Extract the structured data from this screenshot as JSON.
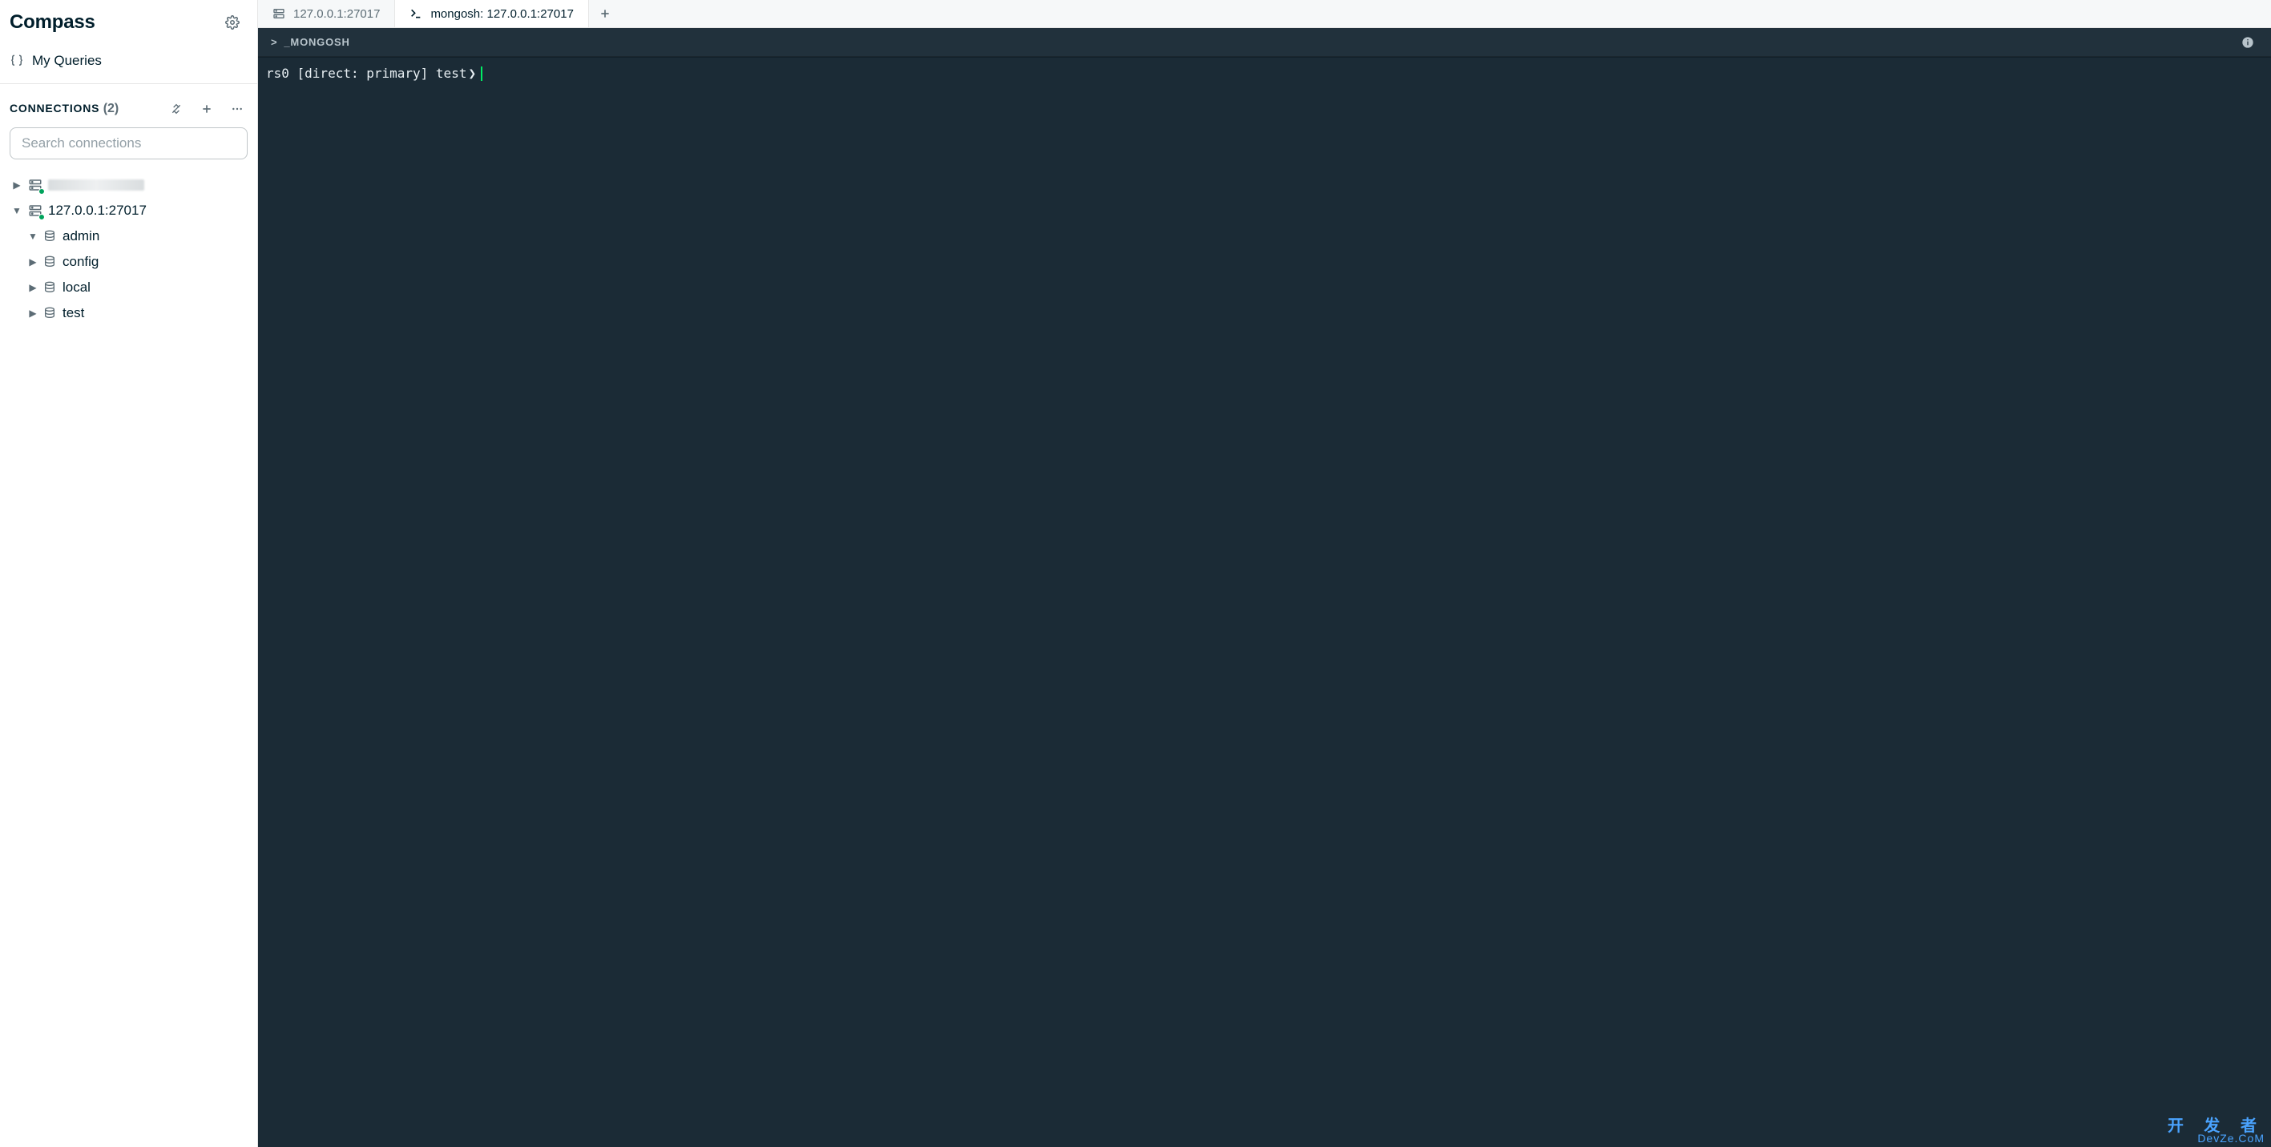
{
  "app": {
    "title": "Compass"
  },
  "sidebar": {
    "myQueries": "My Queries",
    "connectionsLabel": "CONNECTIONS",
    "connectionsCount": "(2)",
    "searchPlaceholder": "Search connections",
    "connections": [
      {
        "label": "",
        "redacted": true,
        "expanded": false
      },
      {
        "label": "127.0.0.1:27017",
        "redacted": false,
        "expanded": true
      }
    ],
    "databases": [
      {
        "label": "admin",
        "expanded": true
      },
      {
        "label": "config",
        "expanded": false
      },
      {
        "label": "local",
        "expanded": false
      },
      {
        "label": "test",
        "expanded": false
      }
    ]
  },
  "tabs": [
    {
      "label": "127.0.0.1:27017",
      "type": "server",
      "active": false
    },
    {
      "label": "mongosh: 127.0.0.1:27017",
      "type": "shell",
      "active": true
    }
  ],
  "shell": {
    "headerLabel": "_MONGOSH",
    "prompt": "rs0 [direct: primary] test"
  },
  "watermark": {
    "line1": "开 发 者",
    "line2": "DevZe.CoM"
  }
}
